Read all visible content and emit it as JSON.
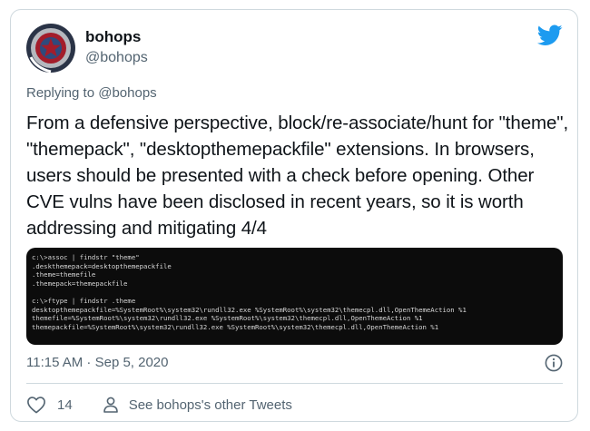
{
  "author": {
    "name": "bohops",
    "handle": "@bohops"
  },
  "reply": {
    "prefix": "Replying to ",
    "to": "@bohops"
  },
  "tweet": {
    "text": "From a defensive perspective, block/re-associate/hunt for \"theme\", \"themepack\", \"desktopthemepackfile\" extensions. In browsers, users should be presented with a check before opening. Other CVE vulns have been disclosed in recent years, so it is worth addressing and mitigating 4/4"
  },
  "terminal": {
    "lines": [
      "c:\\>assoc | findstr \"theme\"",
      ".deskthemepack=desktopthemepackfile",
      ".theme=themefile",
      ".themepack=themepackfile",
      "",
      "c:\\>ftype | findstr .theme",
      "desktopthemepackfile=%SystemRoot%\\system32\\rundll32.exe %SystemRoot%\\system32\\themecpl.dll,OpenThemeAction %1",
      "themefile=%SystemRoot%\\system32\\rundll32.exe %SystemRoot%\\system32\\themecpl.dll,OpenThemeAction %1",
      "themepackfile=%SystemRoot%\\system32\\rundll32.exe %SystemRoot%\\system32\\themecpl.dll,OpenThemeAction %1"
    ]
  },
  "meta": {
    "timestamp": "11:15 AM · Sep 5, 2020"
  },
  "footer": {
    "like_count": "14",
    "other_tweets": "See bohops's other Tweets"
  },
  "icons": {
    "brand": "twitter-bird-icon",
    "like": "heart-icon",
    "profile": "person-icon",
    "info": "info-icon"
  },
  "colors": {
    "brand_blue": "#1d9bf0",
    "text_primary": "#0f1419",
    "text_secondary": "#536471",
    "border": "#cfd9de",
    "terminal_bg": "#0c0c0c"
  }
}
